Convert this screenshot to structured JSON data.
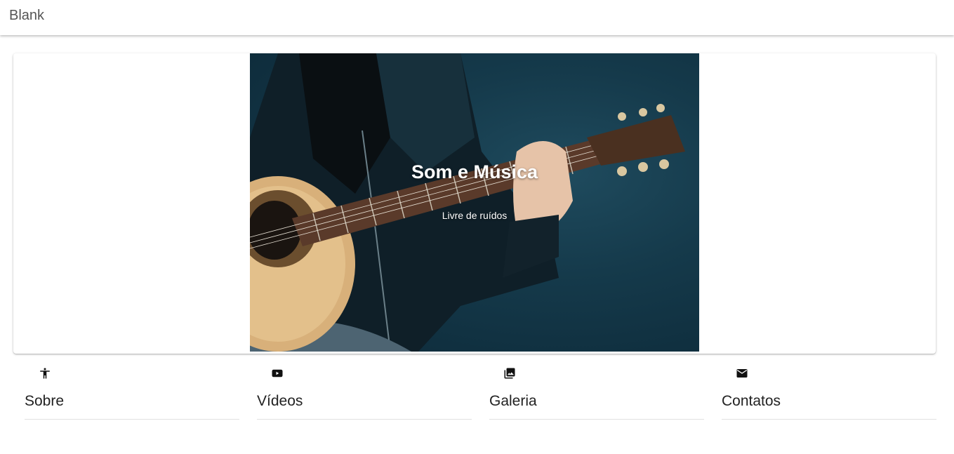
{
  "app_bar": {
    "title": "Blank"
  },
  "hero": {
    "title": "Som e Música",
    "subtitle": "Livre de ruídos",
    "image": "guitar-player-photo"
  },
  "nav": [
    {
      "label": "Sobre",
      "icon": "accessibility-icon"
    },
    {
      "label": "Vídeos",
      "icon": "youtube-icon"
    },
    {
      "label": "Galeria",
      "icon": "photo-library-icon"
    },
    {
      "label": "Contatos",
      "icon": "mail-icon"
    }
  ],
  "colors": {
    "app_bar_bg": "#ffffff",
    "hero_bg": "#153a4b",
    "text": "#222222"
  }
}
